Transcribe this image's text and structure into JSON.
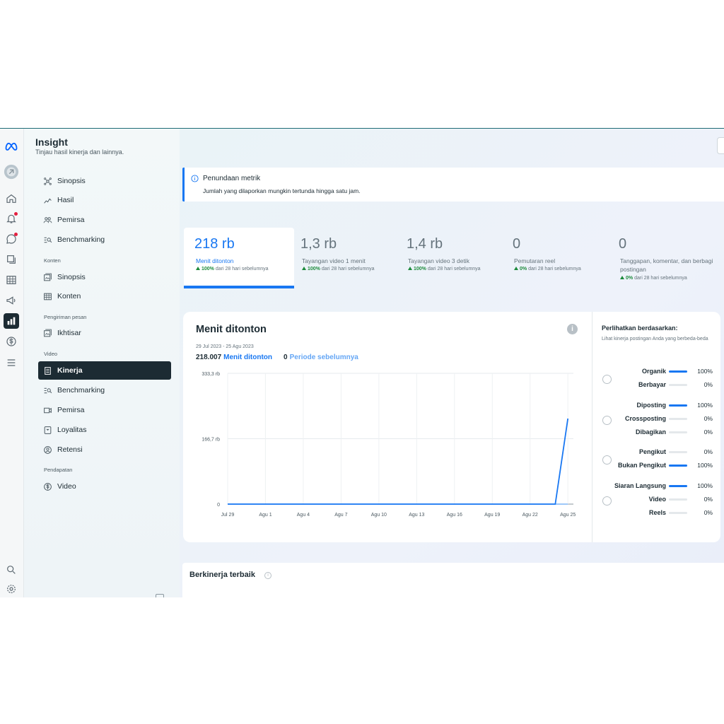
{
  "header": {
    "title": "Insight",
    "subtitle": "Tinjau hasil kinerja dan lainnya."
  },
  "sidebar": {
    "top_items": [
      {
        "label": "Sinopsis",
        "icon": "nodes-icon"
      },
      {
        "label": "Hasil",
        "icon": "trend-icon"
      },
      {
        "label": "Pemirsa",
        "icon": "people-icon"
      },
      {
        "label": "Benchmarking",
        "icon": "benchmark-icon"
      }
    ],
    "sections": [
      {
        "title": "Konten",
        "items": [
          {
            "label": "Sinopsis",
            "icon": "gallery-icon"
          },
          {
            "label": "Konten",
            "icon": "table-icon"
          }
        ]
      },
      {
        "title": "Pengiriman pesan",
        "items": [
          {
            "label": "Ikhtisar",
            "icon": "gallery-icon"
          }
        ]
      },
      {
        "title": "Video",
        "items": [
          {
            "label": "Kinerja",
            "icon": "document-icon",
            "active": true
          },
          {
            "label": "Benchmarking",
            "icon": "benchmark-icon"
          },
          {
            "label": "Pemirsa",
            "icon": "video-icon"
          },
          {
            "label": "Loyalitas",
            "icon": "badge-icon"
          },
          {
            "label": "Retensi",
            "icon": "retention-icon"
          }
        ]
      },
      {
        "title": "Pendapatan",
        "items": [
          {
            "label": "Video",
            "icon": "dollar-icon"
          }
        ]
      }
    ]
  },
  "notice": {
    "title": "Penundaan metrik",
    "body": "Jumlah yang dilaporkan mungkin tertunda hingga satu jam."
  },
  "metrics": [
    {
      "value": "218 rb",
      "label": "Menit ditonton",
      "pct": "100%",
      "suffix": "dari 28 hari sebelumnya",
      "active": true
    },
    {
      "value": "1,3 rb",
      "label": "Tayangan video 1 menit",
      "pct": "100%",
      "suffix": "dari 28 hari sebelumnya"
    },
    {
      "value": "1,4 rb",
      "label": "Tayangan video 3 detik",
      "pct": "100%",
      "suffix": "dari 28 hari sebelumnya"
    },
    {
      "value": "0",
      "label": "Pemutaran reel",
      "pct": "0%",
      "suffix": "dari 28 hari sebelumnya"
    },
    {
      "value": "0",
      "label": "Tanggapan, komentar, dan berbagi postingan",
      "pct": "0%",
      "suffix": "dari 28 hari sebelumnya"
    }
  ],
  "chart_card": {
    "title": "Menit ditonton",
    "date_range": "29 Jul 2023 - 25 Agu 2023",
    "current_value": "218.007",
    "current_label": "Menit ditonton",
    "previous_value": "0",
    "previous_label": "Periode sebelumnya"
  },
  "chart_data": {
    "type": "line",
    "x_ticks": [
      "Jul 29",
      "Agu 1",
      "Agu 4",
      "Agu 7",
      "Agu 10",
      "Agu 13",
      "Agu 16",
      "Agu 19",
      "Agu 22",
      "Agu 25"
    ],
    "y_ticks": [
      "0",
      "166,7 rb",
      "333,3 rb"
    ],
    "ylim": [
      0,
      333300
    ],
    "series": [
      {
        "name": "Menit ditonton",
        "color": "#1877f2",
        "x": [
          "Jul 29",
          "Jul 30",
          "Jul 31",
          "Agu 1",
          "Agu 2",
          "Agu 3",
          "Agu 4",
          "Agu 5",
          "Agu 6",
          "Agu 7",
          "Agu 8",
          "Agu 9",
          "Agu 10",
          "Agu 11",
          "Agu 12",
          "Agu 13",
          "Agu 14",
          "Agu 15",
          "Agu 16",
          "Agu 17",
          "Agu 18",
          "Agu 19",
          "Agu 20",
          "Agu 21",
          "Agu 22",
          "Agu 23",
          "Agu 24",
          "Agu 25"
        ],
        "values": [
          0,
          0,
          0,
          0,
          0,
          0,
          0,
          0,
          0,
          0,
          0,
          0,
          0,
          0,
          0,
          0,
          0,
          0,
          0,
          0,
          0,
          0,
          0,
          0,
          0,
          0,
          0,
          218007
        ]
      },
      {
        "name": "Periode sebelumnya",
        "color": "#64a6f5",
        "values": [
          0,
          0,
          0,
          0,
          0,
          0,
          0,
          0,
          0,
          0,
          0,
          0,
          0,
          0,
          0,
          0,
          0,
          0,
          0,
          0,
          0,
          0,
          0,
          0,
          0,
          0,
          0,
          0
        ]
      }
    ],
    "grid": true
  },
  "breakdown": {
    "title": "Perlihatkan berdasarkan:",
    "subtitle": "Lihat kinerja postingan Anda yang berbeda-beda",
    "groups": [
      {
        "rows": [
          {
            "label": "Organik",
            "pct": "100%",
            "value": 1.0
          },
          {
            "label": "Berbayar",
            "pct": "0%",
            "value": 0.0
          }
        ]
      },
      {
        "rows": [
          {
            "label": "Diposting",
            "pct": "100%",
            "value": 1.0
          },
          {
            "label": "Crossposting",
            "pct": "0%",
            "value": 0.0
          },
          {
            "label": "Dibagikan",
            "pct": "0%",
            "value": 0.0
          }
        ]
      },
      {
        "rows": [
          {
            "label": "Pengikut",
            "pct": "0%",
            "value": 0.0
          },
          {
            "label": "Bukan Pengikut",
            "pct": "100%",
            "value": 1.0
          }
        ]
      },
      {
        "rows": [
          {
            "label": "Siaran Langsung",
            "pct": "100%",
            "value": 1.0
          },
          {
            "label": "Video",
            "pct": "0%",
            "value": 0.0
          },
          {
            "label": "Reels",
            "pct": "0%",
            "value": 0.0
          }
        ]
      }
    ]
  },
  "top_performers": {
    "title": "Berkinerja terbaik"
  },
  "colors": {
    "accent": "#1877f2",
    "positive": "#1c8a3b",
    "dark": "#1c2b33"
  }
}
